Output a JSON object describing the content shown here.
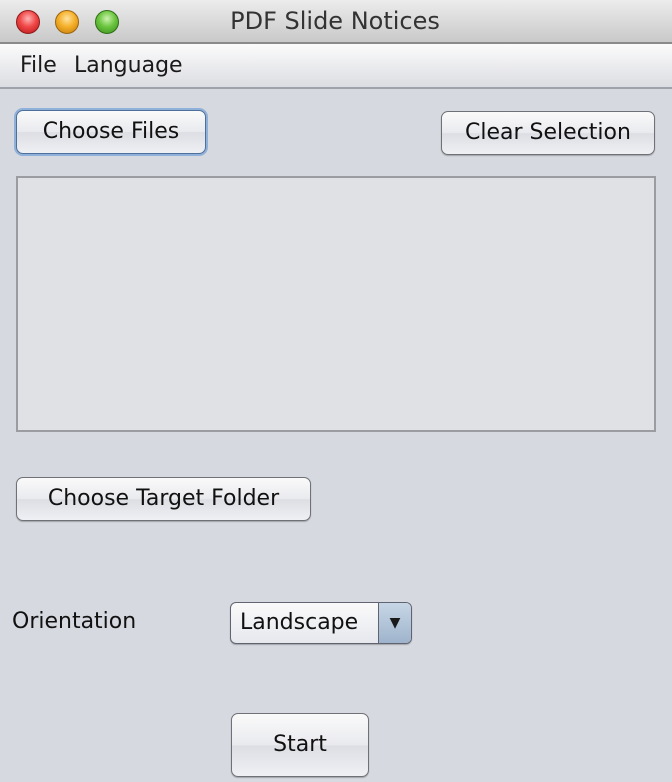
{
  "window": {
    "title": "PDF Slide Notices",
    "controls": {
      "close": "close-window",
      "minimize": "minimize-window",
      "maximize": "zoom-window"
    }
  },
  "menubar": {
    "items": [
      {
        "label": "File"
      },
      {
        "label": "Language"
      }
    ]
  },
  "main": {
    "choose_files_label": "Choose Files",
    "clear_selection_label": "Clear Selection",
    "file_list": {
      "items": []
    },
    "choose_target_folder_label": "Choose Target Folder",
    "orientation": {
      "label": "Orientation",
      "selected": "Landscape",
      "arrow_glyph": "▼"
    },
    "start_label": "Start"
  }
}
